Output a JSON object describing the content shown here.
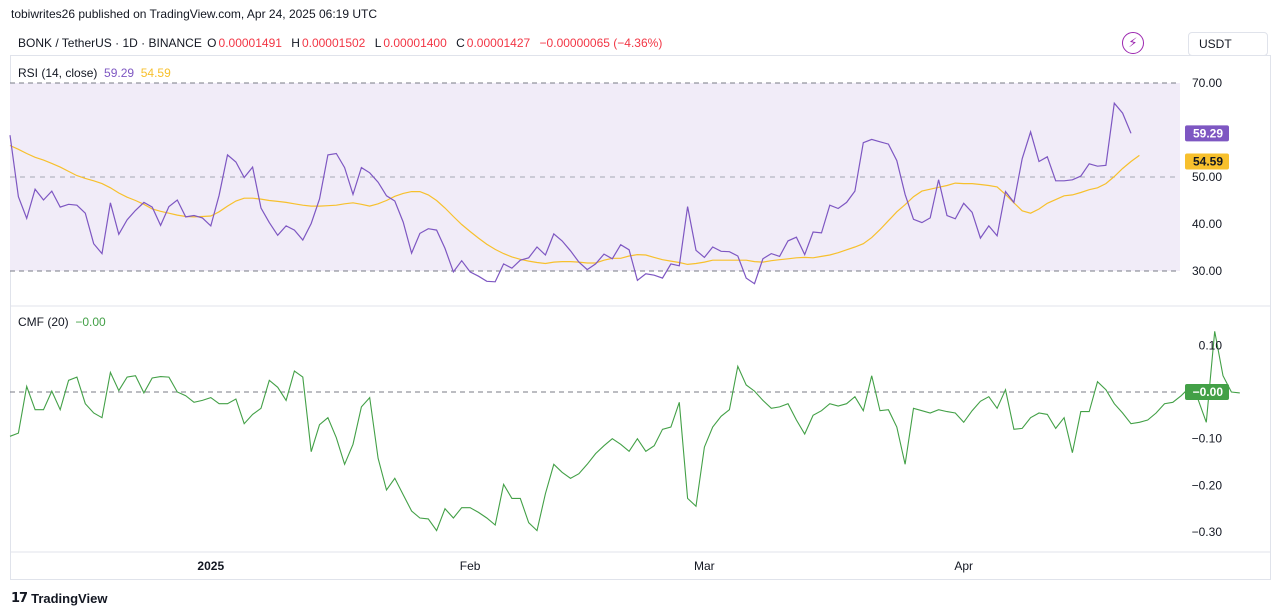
{
  "attribution": "tobiwrites26 published on TradingView.com, Apr 24, 2025 06:19 UTC",
  "header": {
    "symbol": "BONK / TetherUS · 1D · BINANCE",
    "open_label": "O",
    "open": "0.00001491",
    "high_label": "H",
    "high": "0.00001502",
    "low_label": "L",
    "low": "0.00001400",
    "close_label": "C",
    "close": "0.00001427",
    "change": "−0.00000065 (−4.36%)",
    "currency": "USDT"
  },
  "logo": "TradingView",
  "colors": {
    "rsi": "#7e57c2",
    "rsi_ma": "#f7c02d",
    "cmf": "#43a047",
    "rsi_band": "#f1ecf8",
    "negative": "#f23645"
  },
  "chart_data": [
    {
      "type": "line",
      "name_label": "RSI (14, close)",
      "current_rsi": "59.29",
      "current_ma": "54.59",
      "y_ticks": [
        "70.00",
        "50.00",
        "40.00",
        "30.00"
      ],
      "ylim": [
        25.3,
        73.2
      ],
      "band": [
        30,
        70
      ],
      "midline": 50,
      "x_tick_labels": [
        "2025",
        "Feb",
        "Mar",
        "Apr"
      ],
      "x_tick_index": [
        24,
        55,
        83,
        114
      ],
      "series": [
        {
          "name": "RSI",
          "values": [
            58.9,
            45.8,
            41.2,
            47.4,
            45.1,
            47.0,
            43.6,
            44.2,
            44.0,
            42.3,
            35.8,
            33.7,
            44.5,
            37.8,
            40.9,
            42.9,
            44.6,
            43.6,
            39.7,
            43.7,
            45.1,
            41.5,
            41.8,
            41.3,
            39.6,
            46.1,
            54.7,
            53.2,
            49.9,
            52.1,
            43.4,
            40.3,
            37.6,
            39.6,
            38.7,
            36.6,
            40.1,
            45.3,
            54.7,
            55.0,
            52.0,
            46.3,
            52.0,
            50.9,
            48.9,
            46.0,
            44.9,
            40.4,
            33.8,
            38.0,
            39.0,
            38.7,
            34.8,
            29.8,
            32.2,
            29.8,
            28.9,
            27.8,
            27.7,
            31.5,
            30.6,
            32.3,
            32.8,
            35.1,
            33.4,
            37.9,
            36.4,
            34.3,
            31.9,
            30.3,
            31.5,
            33.6,
            32.6,
            35.6,
            34.5,
            28.0,
            29.4,
            29.1,
            28.5,
            31.5,
            31.1,
            43.7,
            34.4,
            32.9,
            35.1,
            34.2,
            34.1,
            33.2,
            28.5,
            27.3,
            32.6,
            33.7,
            33.1,
            36.4,
            37.2,
            33.5,
            38.3,
            38.1,
            44.0,
            43.3,
            44.6,
            47.0,
            57.3,
            58.0,
            57.5,
            57.0,
            53.5,
            46.3,
            41.0,
            40.3,
            41.3,
            49.4,
            41.8,
            41.1,
            44.4,
            42.5,
            37.0,
            39.6,
            37.5,
            46.9,
            44.6,
            53.9,
            59.6,
            53.3,
            54.3,
            49.2,
            49.2,
            49.4,
            50.2,
            52.8,
            52.3,
            52.5,
            65.7,
            63.6,
            59.29
          ]
        },
        {
          "name": "RSI-based MA",
          "values": [
            56.7,
            55.9,
            55.0,
            54.2,
            53.6,
            52.9,
            52.1,
            51.2,
            50.3,
            49.7,
            49.2,
            48.6,
            47.7,
            46.6,
            45.7,
            45.0,
            44.2,
            43.2,
            42.7,
            42.3,
            41.9,
            41.6,
            41.5,
            41.6,
            41.7,
            42.6,
            43.8,
            44.9,
            45.5,
            45.5,
            45.3,
            45.0,
            44.8,
            44.6,
            44.3,
            44.0,
            43.8,
            43.8,
            43.9,
            44.0,
            44.3,
            44.5,
            44.2,
            43.8,
            44.3,
            45.0,
            45.9,
            46.5,
            46.9,
            46.9,
            46.2,
            45.0,
            43.4,
            41.6,
            39.9,
            38.4,
            37.0,
            35.7,
            34.6,
            33.7,
            33.0,
            32.5,
            32.1,
            31.8,
            31.6,
            31.9,
            32.0,
            32.0,
            31.9,
            31.7,
            31.7,
            32.3,
            32.7,
            32.7,
            33.2,
            33.5,
            33.4,
            32.9,
            32.4,
            32.1,
            31.8,
            31.4,
            31.6,
            31.9,
            32.3,
            32.3,
            32.3,
            32.3,
            32.3,
            32.0,
            31.9,
            32.2,
            32.4,
            32.6,
            32.8,
            32.9,
            32.8,
            33.1,
            33.4,
            33.9,
            34.5,
            35.1,
            35.8,
            37.1,
            38.8,
            40.7,
            42.6,
            44.1,
            45.8,
            47.0,
            47.4,
            47.8,
            48.2,
            48.7,
            48.6,
            48.6,
            48.4,
            48.2,
            47.9,
            46.3,
            44.5,
            42.8,
            42.3,
            43.2,
            44.4,
            45.2,
            46.0,
            46.2,
            46.7,
            47.3,
            47.7,
            48.6,
            50.1,
            51.8,
            53.3,
            54.59
          ]
        }
      ]
    },
    {
      "type": "line",
      "name_label": "CMF (20)",
      "current": "−0.00",
      "y_ticks": [
        "0.10",
        "−0.00",
        "−0.10",
        "−0.20",
        "−0.30"
      ],
      "ylim": [
        -0.33,
        0.17
      ],
      "zero_line": 0,
      "series": [
        {
          "name": "CMF",
          "values": [
            -0.095,
            -0.088,
            0.012,
            -0.038,
            -0.038,
            0.002,
            -0.038,
            0.025,
            0.032,
            -0.025,
            -0.045,
            -0.055,
            0.042,
            0.003,
            0.032,
            0.035,
            -0.002,
            0.03,
            0.033,
            0.032,
            0.0,
            -0.008,
            -0.022,
            -0.018,
            -0.012,
            -0.025,
            -0.025,
            -0.015,
            -0.068,
            -0.048,
            -0.035,
            0.025,
            0.01,
            -0.018,
            0.045,
            0.032,
            -0.128,
            -0.07,
            -0.055,
            -0.098,
            -0.155,
            -0.112,
            -0.032,
            -0.012,
            -0.142,
            -0.21,
            -0.185,
            -0.22,
            -0.255,
            -0.27,
            -0.272,
            -0.297,
            -0.25,
            -0.27,
            -0.248,
            -0.248,
            -0.258,
            -0.27,
            -0.285,
            -0.198,
            -0.228,
            -0.228,
            -0.28,
            -0.297,
            -0.218,
            -0.155,
            -0.172,
            -0.185,
            -0.175,
            -0.155,
            -0.132,
            -0.115,
            -0.1,
            -0.112,
            -0.127,
            -0.1,
            -0.127,
            -0.115,
            -0.08,
            -0.075,
            -0.022,
            -0.228,
            -0.245,
            -0.118,
            -0.075,
            -0.052,
            -0.038,
            0.055,
            0.015,
            0.002,
            -0.018,
            -0.035,
            -0.032,
            -0.025,
            -0.06,
            -0.09,
            -0.05,
            -0.04,
            -0.025,
            -0.03,
            -0.025,
            -0.01,
            -0.04,
            0.035,
            -0.04,
            -0.038,
            -0.075,
            -0.155,
            -0.035,
            -0.04,
            -0.045,
            -0.038,
            -0.042,
            -0.045,
            -0.065,
            -0.04,
            -0.02,
            -0.01,
            -0.035,
            0.005,
            -0.08,
            -0.078,
            -0.055,
            -0.045,
            -0.048,
            -0.078,
            -0.055,
            -0.13,
            -0.042,
            -0.042,
            0.022,
            0.005,
            -0.025,
            -0.045,
            -0.068,
            -0.065,
            -0.06,
            -0.045,
            -0.025,
            -0.022,
            -0.008,
            0.01,
            -0.015,
            -0.065,
            0.13,
            0.035,
            0.0,
            -0.002
          ]
        }
      ]
    }
  ]
}
